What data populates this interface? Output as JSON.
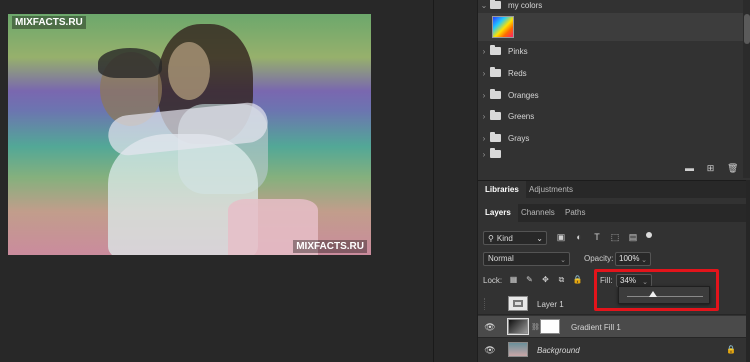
{
  "canvas": {
    "watermark_top": "MIXFACTS.RU",
    "watermark_bottom": "MIXFACTS.RU"
  },
  "swatches": {
    "group_open": {
      "label": "my colors",
      "expanded": true
    },
    "groups": [
      {
        "label": "Pinks"
      },
      {
        "label": "Reds"
      },
      {
        "label": "Oranges"
      },
      {
        "label": "Greens"
      },
      {
        "label": "Grays"
      }
    ],
    "tools": [
      "folder-icon",
      "new-swatch-icon",
      "trash-icon"
    ]
  },
  "panel_tabs_top": [
    {
      "label": "Libraries",
      "active": true
    },
    {
      "label": "Adjustments",
      "active": false
    }
  ],
  "panel_tabs_layers": [
    {
      "label": "Layers",
      "active": true
    },
    {
      "label": "Channels",
      "active": false
    },
    {
      "label": "Paths",
      "active": false
    }
  ],
  "layers_panel": {
    "filter_kind": "Kind",
    "blend_mode": "Normal",
    "opacity_label": "Opacity:",
    "opacity_value": "100%",
    "lock_label": "Lock:",
    "fill_label": "Fill:",
    "fill_value": "34%",
    "fill_slider_fraction": 0.34,
    "highlight_color": "#e3141b",
    "layers": [
      {
        "name": "Layer 1",
        "visible": false,
        "italic": false,
        "selected": false,
        "locked": false
      },
      {
        "name": "Gradient Fill 1",
        "visible": true,
        "italic": false,
        "selected": true,
        "locked": false
      },
      {
        "name": "Background",
        "visible": true,
        "italic": true,
        "selected": false,
        "locked": true
      }
    ]
  }
}
